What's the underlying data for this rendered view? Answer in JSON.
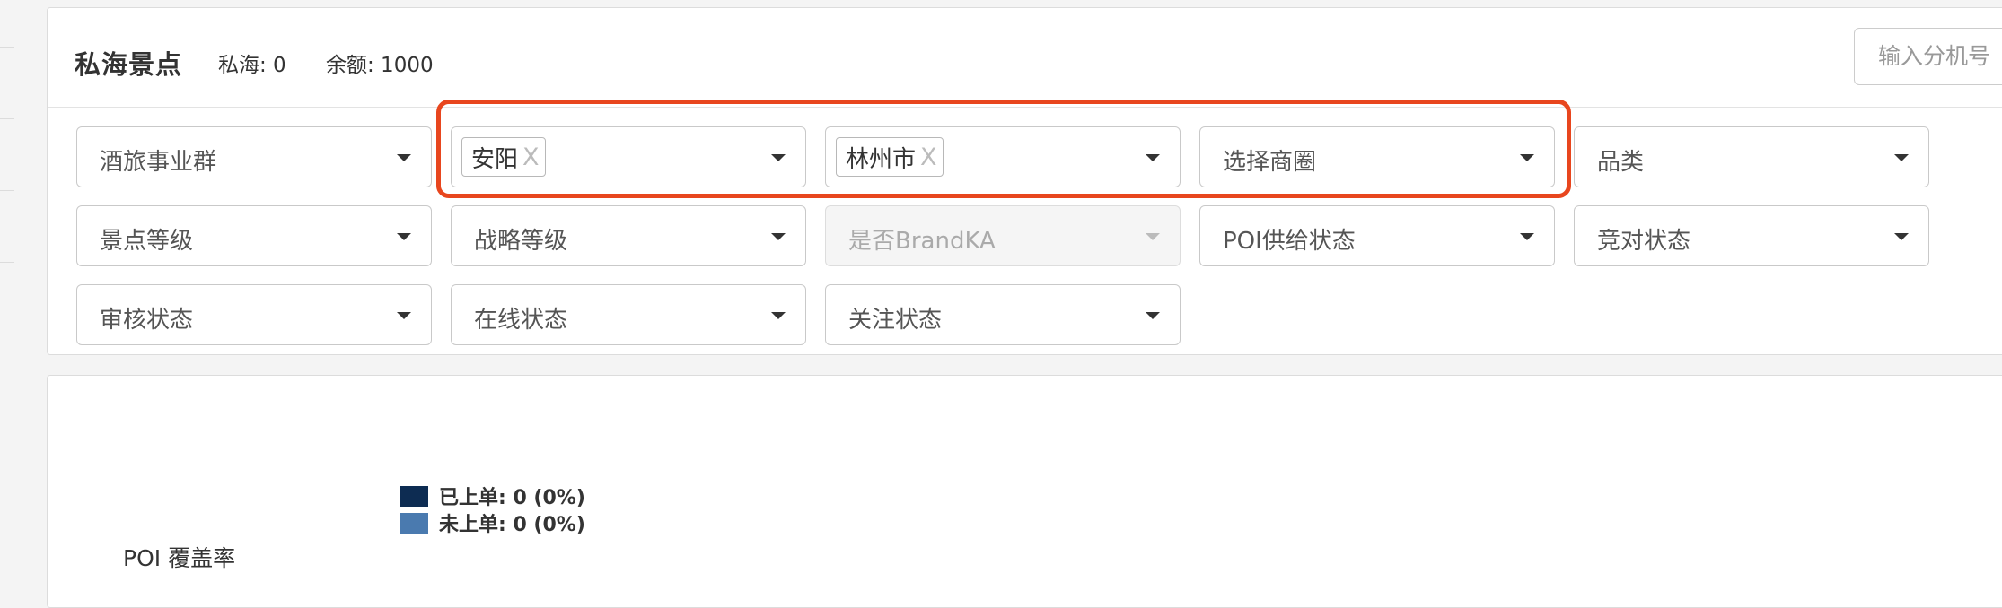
{
  "header": {
    "title": "私海景点",
    "private_count": "私海: 0",
    "balance": "余额: 1000",
    "search_placeholder": "输入分机号"
  },
  "filters": {
    "business_group": "酒旅事业群",
    "province_tag": "安阳",
    "city_tag": "林州市",
    "tag_remove_glyph": "X",
    "business_circle": "选择商圈",
    "category": "品类",
    "scenic_level": "景点等级",
    "strategy_level": "战略等级",
    "brand_ka": "是否BrandKA",
    "poi_supply_status": "POI供给状态",
    "competitor_status": "竞对状态",
    "review_status": "审核状态",
    "online_status": "在线状态",
    "follow_status": "关注状态"
  },
  "chart": {
    "title": "POI 覆盖率"
  },
  "chart_data": {
    "type": "pie",
    "title": "POI 覆盖率",
    "legend_position": "top-left",
    "slices": [
      {
        "label": "已上单: 0 (0%)",
        "value": 0,
        "percent": 0,
        "color": "#0d2c52"
      },
      {
        "label": "未上单: 0 (0%)",
        "value": 0,
        "percent": 0,
        "color": "#4a7aaf"
      }
    ]
  }
}
